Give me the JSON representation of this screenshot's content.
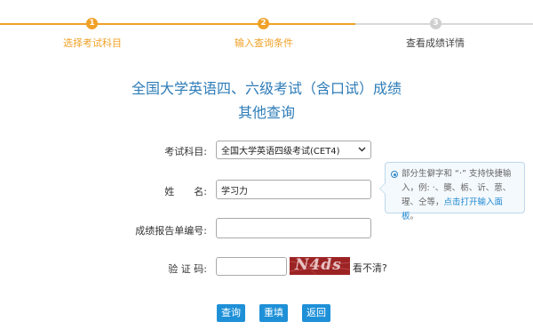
{
  "steps": [
    {
      "number": "1",
      "label": "选择考试科目",
      "state": "done"
    },
    {
      "number": "2",
      "label": "输入查询条件",
      "state": "active"
    },
    {
      "number": "3",
      "label": "查看成绩详情",
      "state": "pending"
    }
  ],
  "colors": {
    "accent_orange": "#f0a127",
    "gray": "#cfcfcf",
    "title_blue": "#2e7cb8",
    "button_blue": "#1e90d8",
    "captcha_bg": "#9c2324"
  },
  "page": {
    "title_line1": "全国大学英语四、六级考试（含口试）成绩",
    "title_line2": "其他查询"
  },
  "form": {
    "subject_label": "考试科目:",
    "subject_value": "全国大学英语四级考试(CET4)",
    "name_label": "姓　　名:",
    "name_value": "学习力",
    "report_label": "成绩报告单编号:",
    "report_value": "",
    "captcha_label": "验  证  码:",
    "captcha_value": "",
    "captcha_image_text": "N4ds",
    "refresh_label": "看不清?"
  },
  "tip": {
    "text": "部分生僻字和 “·” 支持快捷输入，例: ·、龑、栃、䜣、葸、瑆、仝等，",
    "link": "点击打开输入面板",
    "end": "。"
  },
  "buttons": {
    "query": "查询",
    "reset": "重填",
    "back": "返回"
  }
}
